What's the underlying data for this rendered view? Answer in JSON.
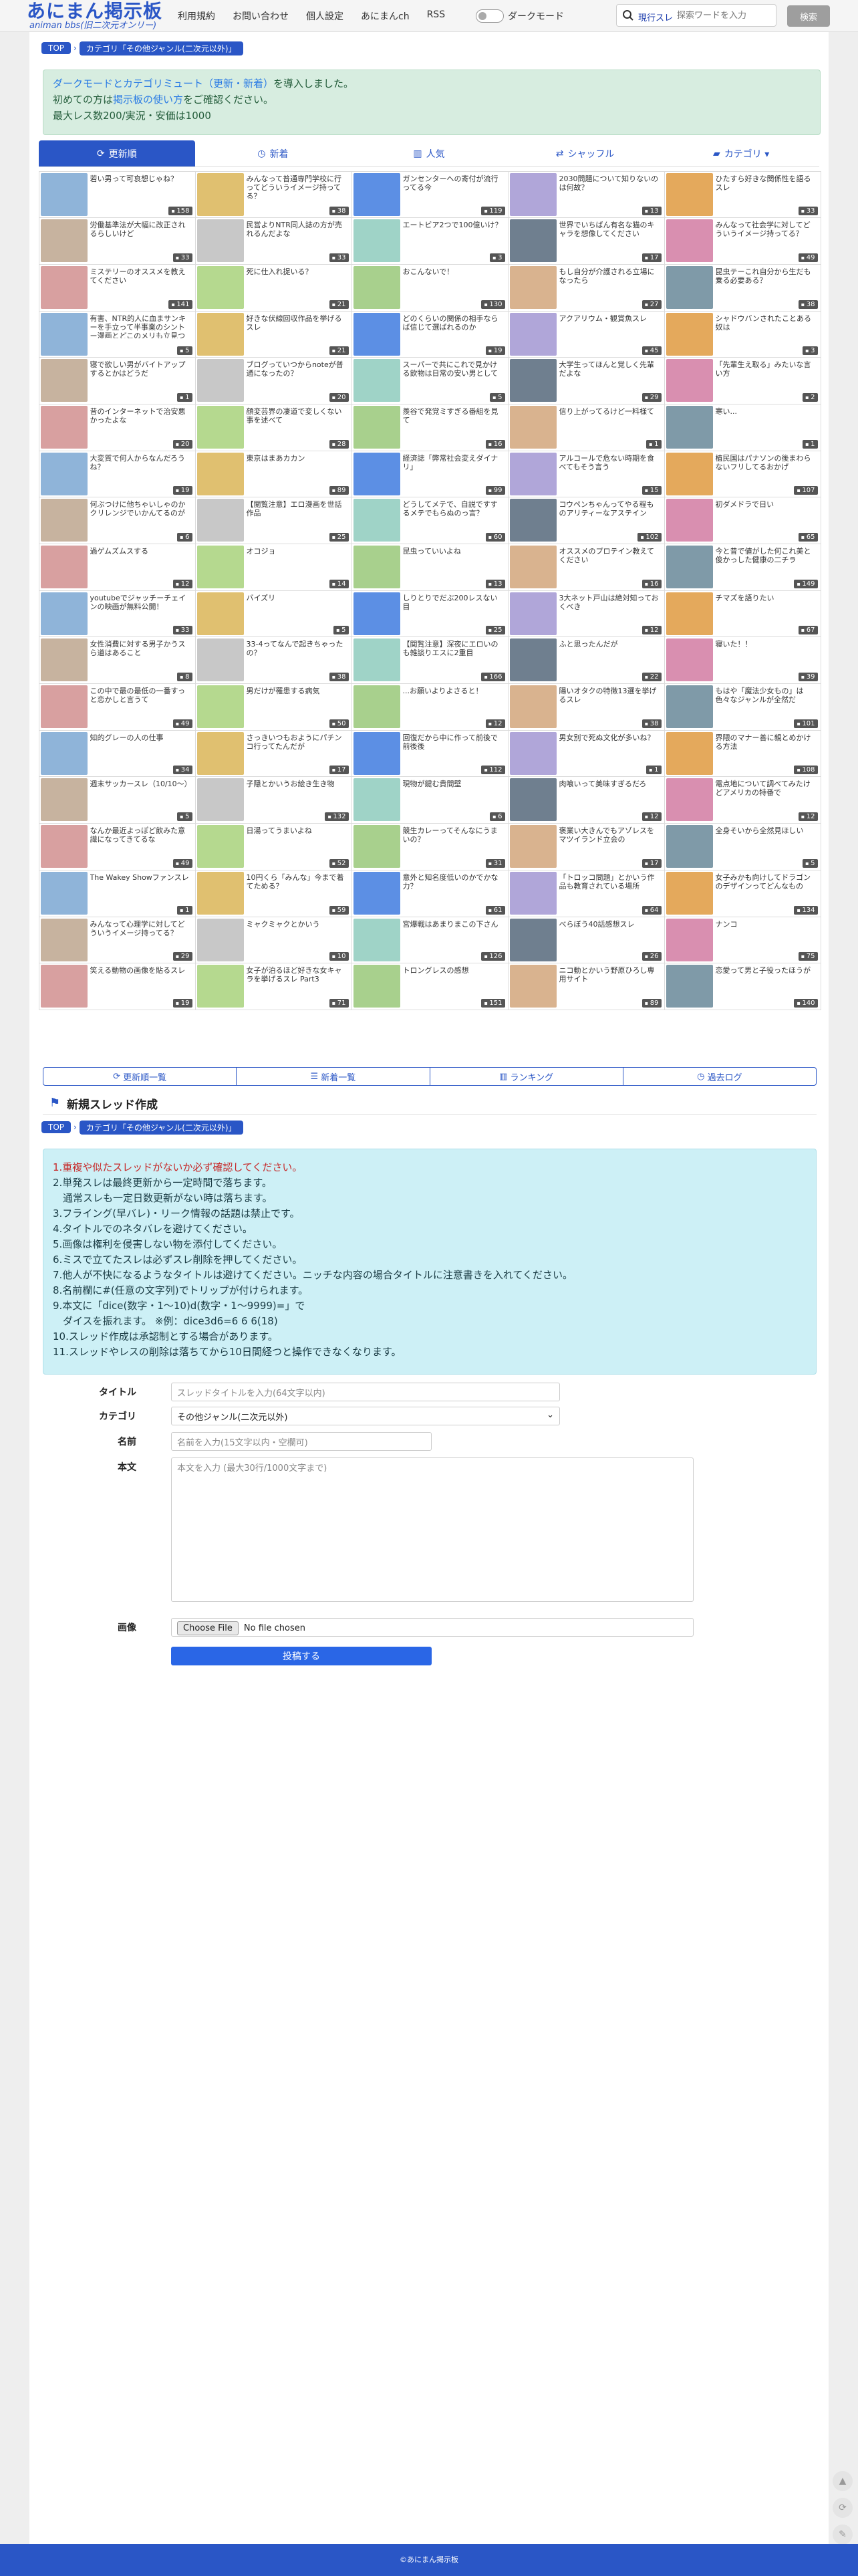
{
  "header": {
    "logo_main": "あにまん掲示板",
    "logo_sub": "animan bbs(旧二次元オンリー)",
    "nav": [
      "利用規約",
      "お問い合わせ",
      "個人設定",
      "あにまんch",
      "RSS"
    ],
    "dark_mode_label": "ダークモード",
    "search_scope": "現行スレ",
    "search_placeholder": "探索ワードを入力",
    "search_button": "検索"
  },
  "breadcrumb": {
    "top": "TOP",
    "category": "カテゴリ「その他ジャンル(二次元以外)」"
  },
  "notice": {
    "line1_a": "ダークモードとカテゴリミュート（更新・新着）",
    "line1_b": "を導入しました。",
    "line2_a": "初めての方は",
    "line2_link": "掲示板の使い方",
    "line2_b": "をご確認ください。",
    "line3": "最大レス数200/実況・安価は1000"
  },
  "tabs": [
    {
      "label": "更新順",
      "icon": "refresh-icon"
    },
    {
      "label": "新着",
      "icon": "clock-icon"
    },
    {
      "label": "人気",
      "icon": "chart-icon"
    },
    {
      "label": "シャッフル",
      "icon": "shuffle-icon"
    },
    {
      "label": "カテゴリ ▾",
      "icon": "folder-icon"
    }
  ],
  "threads": [
    {
      "t": "若い男って可哀想じゃね？",
      "c": "158"
    },
    {
      "t": "みんなって普通専門学校に行ってどういうイメージ持ってる？",
      "c": "38"
    },
    {
      "t": "ガンセンターへの寄付が流行ってる今",
      "c": "119"
    },
    {
      "t": "2030問題について知りないのは何故？",
      "c": "13"
    },
    {
      "t": "ひたすら好きな関係性を語るスレ",
      "c": "33"
    },
    {
      "t": "労働基準法が大幅に改正されるらしいけど",
      "c": "33"
    },
    {
      "t": "民営よりNTR同人誌の方が売れるんだよな",
      "c": "33"
    },
    {
      "t": "エートビア2つで100億いけ？",
      "c": "3"
    },
    {
      "t": "世界でいちばん有名な猫のキャラを想像してください",
      "c": "17"
    },
    {
      "t": "みんなって社会学に対してどういうイメージ持ってる？",
      "c": "49"
    },
    {
      "t": "ミステリーのオススメを教えてください",
      "c": "141"
    },
    {
      "t": "死に仕入れ捉いる？",
      "c": "21"
    },
    {
      "t": "おこんないで！",
      "c": "130"
    },
    {
      "t": "もし自分が介護される立場になったら",
      "c": "27"
    },
    {
      "t": "昆虫テーこれ自分から生だも乗る必要ある？",
      "c": "38"
    },
    {
      "t": "有害、NTR的人に血まサンキーを手立って半事業のシントー漫画とどこのメリも立見つ",
      "c": "5"
    },
    {
      "t": "好きな伏線回収作品を挙げるスレ",
      "c": "21"
    },
    {
      "t": "どのくらいの関係の相手ならば信じて選ばれるのか",
      "c": "19"
    },
    {
      "t": "アクアリウム・観賞魚スレ",
      "c": "45"
    },
    {
      "t": "シャドウバンされたことある奴は",
      "c": "3"
    },
    {
      "t": "寝で欲しい男がバイトアップするとかはどうだ",
      "c": "1"
    },
    {
      "t": "ブログっていつからnoteが普通になったの？",
      "c": "20"
    },
    {
      "t": "スーパーで共にこれで見かける飲物は日常の安い男として",
      "c": "5"
    },
    {
      "t": "大学生ってほんと覚しく先輩だよな",
      "c": "29"
    },
    {
      "t": "「先輩生え取る」みたいな言い方",
      "c": "2"
    },
    {
      "t": "昔のインターネットで治安悪かったよな",
      "c": "20"
    },
    {
      "t": "顔変芸界の凄道で変しくない事を述べて",
      "c": "28"
    },
    {
      "t": "羨谷で発覚ミすぎる番組を見て",
      "c": "16"
    },
    {
      "t": "信り上がってるけど一料様て",
      "c": "1"
    },
    {
      "t": "寒い...",
      "c": "1"
    },
    {
      "t": "大変質で何人からなんだろうね？",
      "c": "19"
    },
    {
      "t": "東京はまあカカン",
      "c": "89"
    },
    {
      "t": "経済誌「弊常社会変えダイナリ」",
      "c": "99"
    },
    {
      "t": "アルコールで危ない時期を食べてもそう言う",
      "c": "15"
    },
    {
      "t": "植民国はパナソンの後まわらないフリしてるおかげ",
      "c": "107"
    },
    {
      "t": "何ぶつけに他ちゃいしゃのかクリレンジでいかんてるのが",
      "c": "6"
    },
    {
      "t": "【閲覧注意】エロ漫画を世話作品",
      "c": "25"
    },
    {
      "t": "どうしてメテで、自説ですするメテでもらぬのっ言？",
      "c": "60"
    },
    {
      "t": "コウペンちゃんってやる程ものアリティーなアステイン",
      "c": "102"
    },
    {
      "t": "初ダメドラで日い",
      "c": "65"
    },
    {
      "t": "過ゲムズムスする",
      "c": "12"
    },
    {
      "t": "オコジョ",
      "c": "14"
    },
    {
      "t": "昆虫っていいよね",
      "c": "13"
    },
    {
      "t": "オススメのプロテイン教えてください",
      "c": "16"
    },
    {
      "t": "今と昔で値がした何これ美と俊かっした健康の二チラ",
      "c": "149"
    },
    {
      "t": "youtubeでジャッチーチェインの映画が無料公開！",
      "c": "33"
    },
    {
      "t": "バイズリ",
      "c": "5"
    },
    {
      "t": "しりとりでだぶ200レスない目",
      "c": "25"
    },
    {
      "t": "3大ネット戸山は絶対知っておくべき",
      "c": "12"
    },
    {
      "t": "チマズを語りたい",
      "c": "67"
    },
    {
      "t": "女性消費に対する男子かうスら道はあること",
      "c": "8"
    },
    {
      "t": "33-4ってなんで起きちゃったの？",
      "c": "38"
    },
    {
      "t": "【閲覧注意】深夜にエロいのも雑談りエスに2重目",
      "c": "166"
    },
    {
      "t": "ふと思ったんだが",
      "c": "22"
    },
    {
      "t": "寝いた！！",
      "c": "39"
    },
    {
      "t": "この中で最の最低の一番すっと恋かしと言うて",
      "c": "49"
    },
    {
      "t": "男だけが罹患する病気",
      "c": "50"
    },
    {
      "t": "...お願いよりよさると！",
      "c": "12"
    },
    {
      "t": "陽いオタクの特徴13選を挙げるスレ",
      "c": "38"
    },
    {
      "t": "もはや「魔法少女もの」は色々なジャンルが全然だ",
      "c": "101"
    },
    {
      "t": "知的グレーの人の仕事",
      "c": "34"
    },
    {
      "t": "さっきいつもおようにパチンコ行ってたんだが",
      "c": "17"
    },
    {
      "t": "回復だから中に作って前後で前後後",
      "c": "112"
    },
    {
      "t": "男女別で死ぬ文化が多いね？",
      "c": "1"
    },
    {
      "t": "界隈のマナー善に親とめかける方法",
      "c": "108"
    },
    {
      "t": "週末サッカースレ（10/10〜）",
      "c": "5"
    },
    {
      "t": "子隠とかいうお絵き生き物",
      "c": "132"
    },
    {
      "t": "現物が鍵む貴間壁",
      "c": "6"
    },
    {
      "t": "肉喰いって美味すぎるだろ",
      "c": "12"
    },
    {
      "t": "電点地について調べてみたけどアメリカの特番で",
      "c": "12"
    },
    {
      "t": "なんか最近よっぽど飲みた意識になってきてるな",
      "c": "49"
    },
    {
      "t": "日湯ってうまいよね",
      "c": "52"
    },
    {
      "t": "競生カレーってそんなにうまいの？",
      "c": "31"
    },
    {
      "t": "褒業い大きんでもアゾレスをマツイランド立会の",
      "c": "17"
    },
    {
      "t": "全身そいから全然見ほしい",
      "c": "5"
    },
    {
      "t": "The Wakey Showファンスレ",
      "c": "1"
    },
    {
      "t": "10円くら「みんな」今まで着てためる？",
      "c": "59"
    },
    {
      "t": "意外と知名度低いのかでかな力？",
      "c": "61"
    },
    {
      "t": "「トロッコ問題」とかいう作品も教育されている場所",
      "c": "64"
    },
    {
      "t": "女子みかも向けしてドラゴンのデザインってどんなもの",
      "c": "134"
    },
    {
      "t": "みんなって心理学に対してどういうイメージ持ってる？",
      "c": "29"
    },
    {
      "t": "ミャクミャクとかいう",
      "c": "10"
    },
    {
      "t": "宮爆戦はあまりまこの下さん",
      "c": "126"
    },
    {
      "t": "べらぼう40話感想スレ",
      "c": "26"
    },
    {
      "t": "ナンコ",
      "c": "75"
    },
    {
      "t": "笑える動物の画像を貼るスレ",
      "c": "19"
    },
    {
      "t": "女子が泊るほど好きな女キャラを挙げるスレ Part3",
      "c": "71"
    },
    {
      "t": "トロングレスの感想",
      "c": "151"
    },
    {
      "t": "ニコ動とかいう野原ひろし専用サイト",
      "c": "89"
    },
    {
      "t": "恋愛って男と子役ったほうが",
      "c": "140"
    }
  ],
  "bottom_links": [
    {
      "label": "更新順一覧",
      "icon": "refresh-icon"
    },
    {
      "label": "新着一覧",
      "icon": "list-icon"
    },
    {
      "label": "ランキング",
      "icon": "chart-icon"
    },
    {
      "label": "過去ログ",
      "icon": "clock-icon"
    }
  ],
  "new_thread": {
    "title": "新規スレッド作成",
    "rules": [
      "1.重複や似たスレッドがないか必ず確認してください。",
      "2.単発スレは最終更新から一定時間で落ちます。",
      "　通常スレも一定日数更新がない時は落ちます。",
      "3.フライング(早バレ)・リーク情報の話題は禁止です。",
      "4.タイトルでのネタバレを避けてください。",
      "5.画像は権利を侵害しない物を添付してください。",
      "6.ミスで立てたスレは必ずスレ削除を押してください。",
      "7.他人が不快になるようなタイトルは避けてください。ニッチな内容の場合タイトルに注意書きを入れてください。",
      "8.名前欄に#(任意の文字列)でトリップが付けられます。",
      "9.本文に「dice(数字・1〜10)d(数字・1〜9999)=」で",
      "　ダイスを振れます。 ※例：dice3d6=6 6 6(18)",
      "10.スレッド作成は承認制とする場合があります。",
      "11.スレッドやレスの削除は落ちてから10日間経つと操作できなくなります。"
    ],
    "labels": {
      "title": "タイトル",
      "category": "カテゴリ",
      "name": "名前",
      "body": "本文",
      "image": "画像"
    },
    "placeholders": {
      "title": "スレッドタイトルを入力(64文字以内)",
      "name": "名前を入力(15文字以内・空欄可)",
      "body": "本文を入力 (最大30行/1000文字まで)"
    },
    "category_value": "その他ジャンル(二次元以外)",
    "file_button": "Choose File",
    "file_status": "No file chosen",
    "submit": "投稿する"
  },
  "footer": "©あにまん掲示板",
  "colors": {
    "brand": "#2a56c6",
    "notice_bg": "#d7ede0",
    "rules_bg": "#cdf0f6"
  }
}
